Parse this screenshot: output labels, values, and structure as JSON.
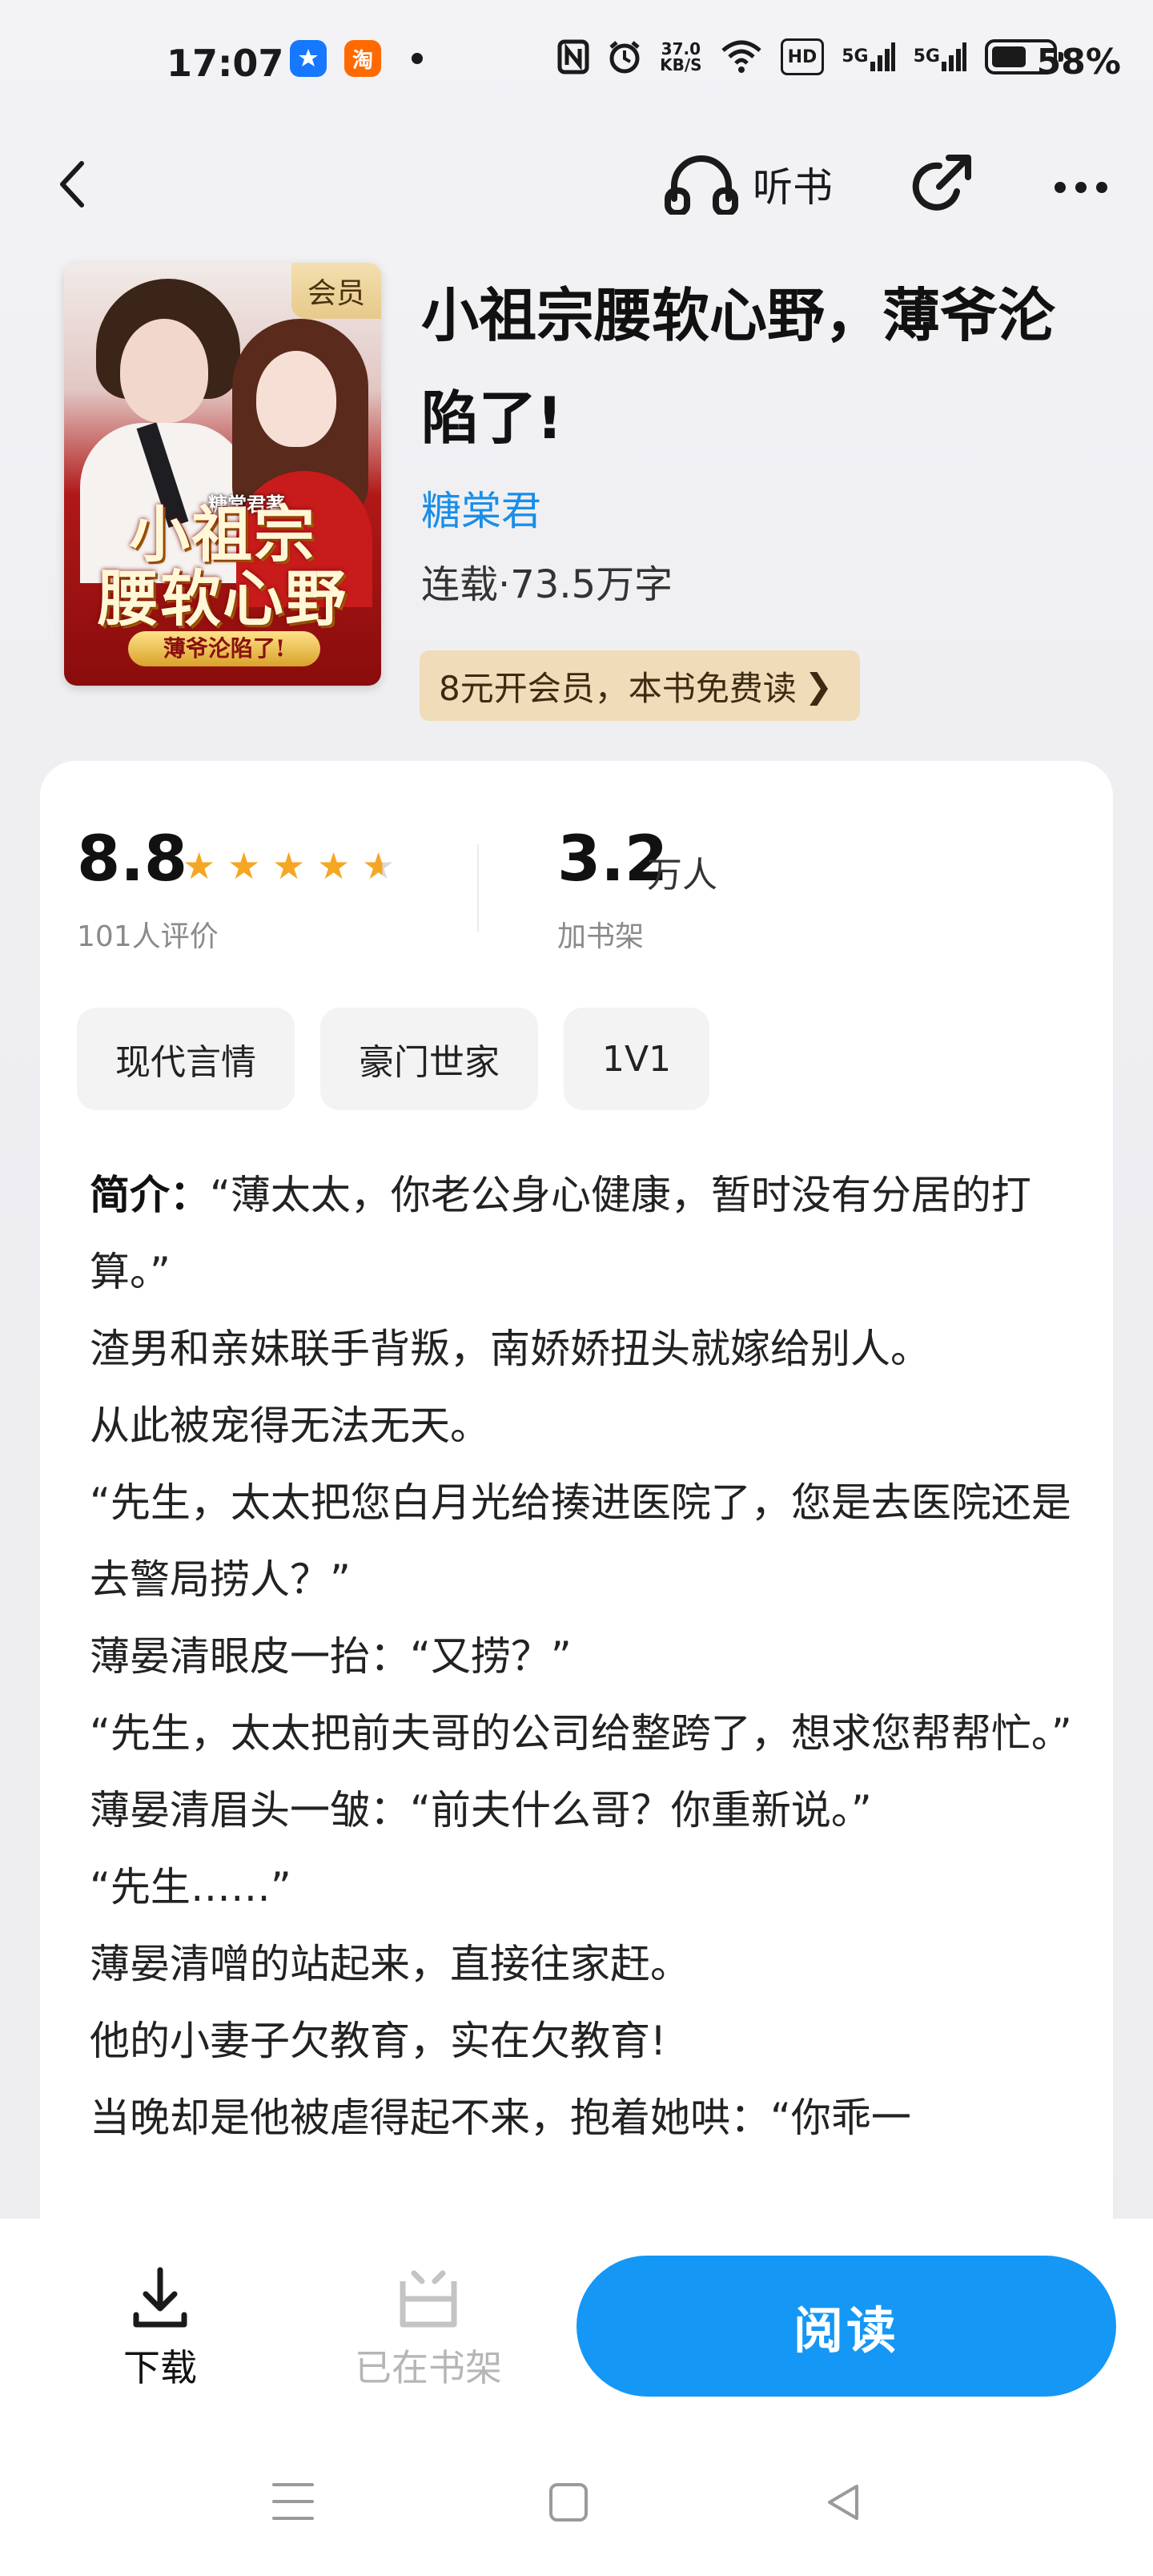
{
  "status_bar": {
    "time": "17:07",
    "left_apps": [
      "alipay-icon",
      "taobao-icon"
    ],
    "taobao_label": "淘",
    "net_speed_value": "37.0",
    "net_speed_unit": "KB/S",
    "hd_label": "HD",
    "sim1": "5G",
    "sim2": "5G",
    "battery_pct": "58%",
    "battery_level": 0.58
  },
  "nav": {
    "listen_label": "听书"
  },
  "book": {
    "title": "小祖宗腰软心野，薄爷沦陷了!",
    "author": "糖棠君",
    "meta": "连载·73.5万字",
    "vip_tag": "会员",
    "vip_promo": "8元开会员，本书免费读",
    "vip_promo_chevron": "❯",
    "cover": {
      "author": "糖棠君著",
      "title_line1": "小祖宗",
      "title_line2": "腰软心野",
      "subtitle": "薄爷沦陷了!"
    }
  },
  "stats": {
    "rating": "8.8",
    "stars": 4.5,
    "rating_count": "101人评价",
    "shelf_count": "3.2",
    "shelf_unit": "万人",
    "shelf_label": "加书架"
  },
  "tags": [
    "现代言情",
    "豪门世家",
    "1V1"
  ],
  "intro": {
    "label": "简介：",
    "lines": [
      "“薄太太，你老公身心健康，暂时没有分居的打算。”",
      "渣男和亲妹联手背叛，南娇娇扭头就嫁给别人。",
      "从此被宠得无法无天。",
      "“先生，太太把您白月光给揍进医院了，您是去医院还是去警局捞人？”",
      "薄晏清眼皮一抬：“又捞？”",
      "“先生，太太把前夫哥的公司给整跨了，想求您帮帮忙。”",
      "薄晏清眉头一皱：“前夫什么哥？你重新说。”",
      "“先生……”",
      "薄晏清噌的站起来，直接往家赶。",
      "他的小妻子欠教育，实在欠教育!",
      "当晚却是他被虐得起不来，抱着她哄：“你乖一"
    ]
  },
  "bottom_bar": {
    "download_label": "下载",
    "shelf_label": "已在书架",
    "read_label": "阅读"
  },
  "colors": {
    "accent": "#1597f5",
    "author_link": "#1a8ee8",
    "star": "#f5a623",
    "vip_bg": "#f0dcb8"
  }
}
